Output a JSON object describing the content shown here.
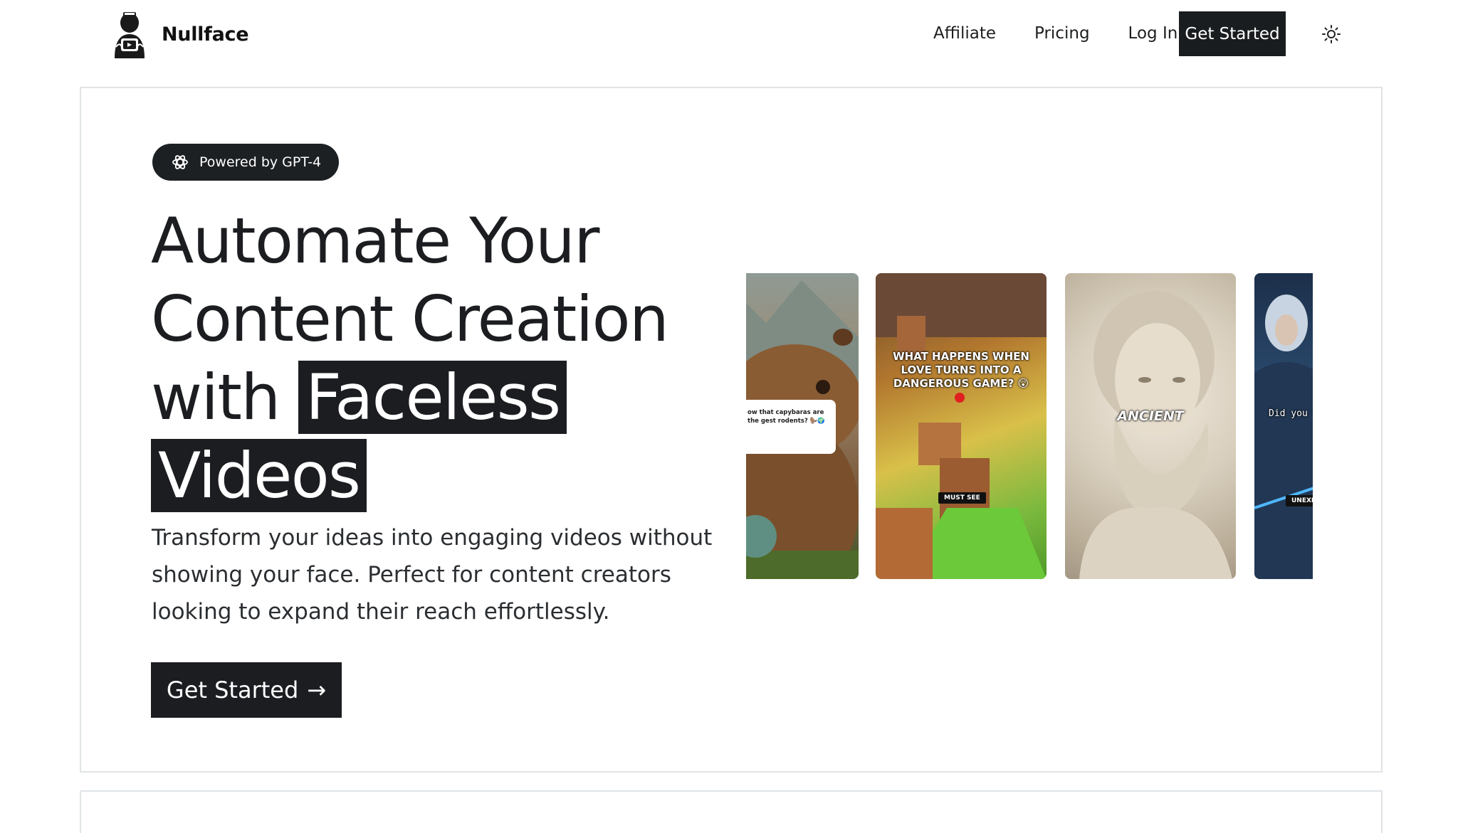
{
  "brand": {
    "name": "Nullface"
  },
  "nav": {
    "links": [
      "Affiliate",
      "Pricing",
      "Log In"
    ],
    "cta": "Get Started"
  },
  "hero": {
    "badge": "Powered by GPT-4",
    "headline_plain_1": "Automate Your",
    "headline_plain_2": "Content Creation",
    "headline_plain_3": "with",
    "headline_highlight_1": "Faceless",
    "headline_highlight_2": "Videos",
    "subtext": "Transform your ideas into engaging videos without showing your face. Perfect for content creators looking to expand their reach effortlessly.",
    "cta": "Get Started",
    "cta_arrow": "→"
  },
  "videos": [
    {
      "caption": "ow that capybaras are the gest rodents? 🦫🌍",
      "subject": "capybara"
    },
    {
      "caption": "WHAT HAPPENS WHEN LOVE TURNS INTO A DANGEROUS GAME? 😲",
      "tag": "MUST SEE",
      "subject": "minecraft"
    },
    {
      "caption": "ANCIENT",
      "subject": "statue"
    },
    {
      "caption": "Did you bel",
      "tag": "UNEXPE",
      "subject": "warrior"
    }
  ],
  "colors": {
    "dark": "#1b1d21",
    "border": "#e1e4e7",
    "background": "#ffffff"
  },
  "icons": {
    "badge": "openai-icon",
    "theme": "sun-icon",
    "cta": "arrow-right-icon"
  }
}
